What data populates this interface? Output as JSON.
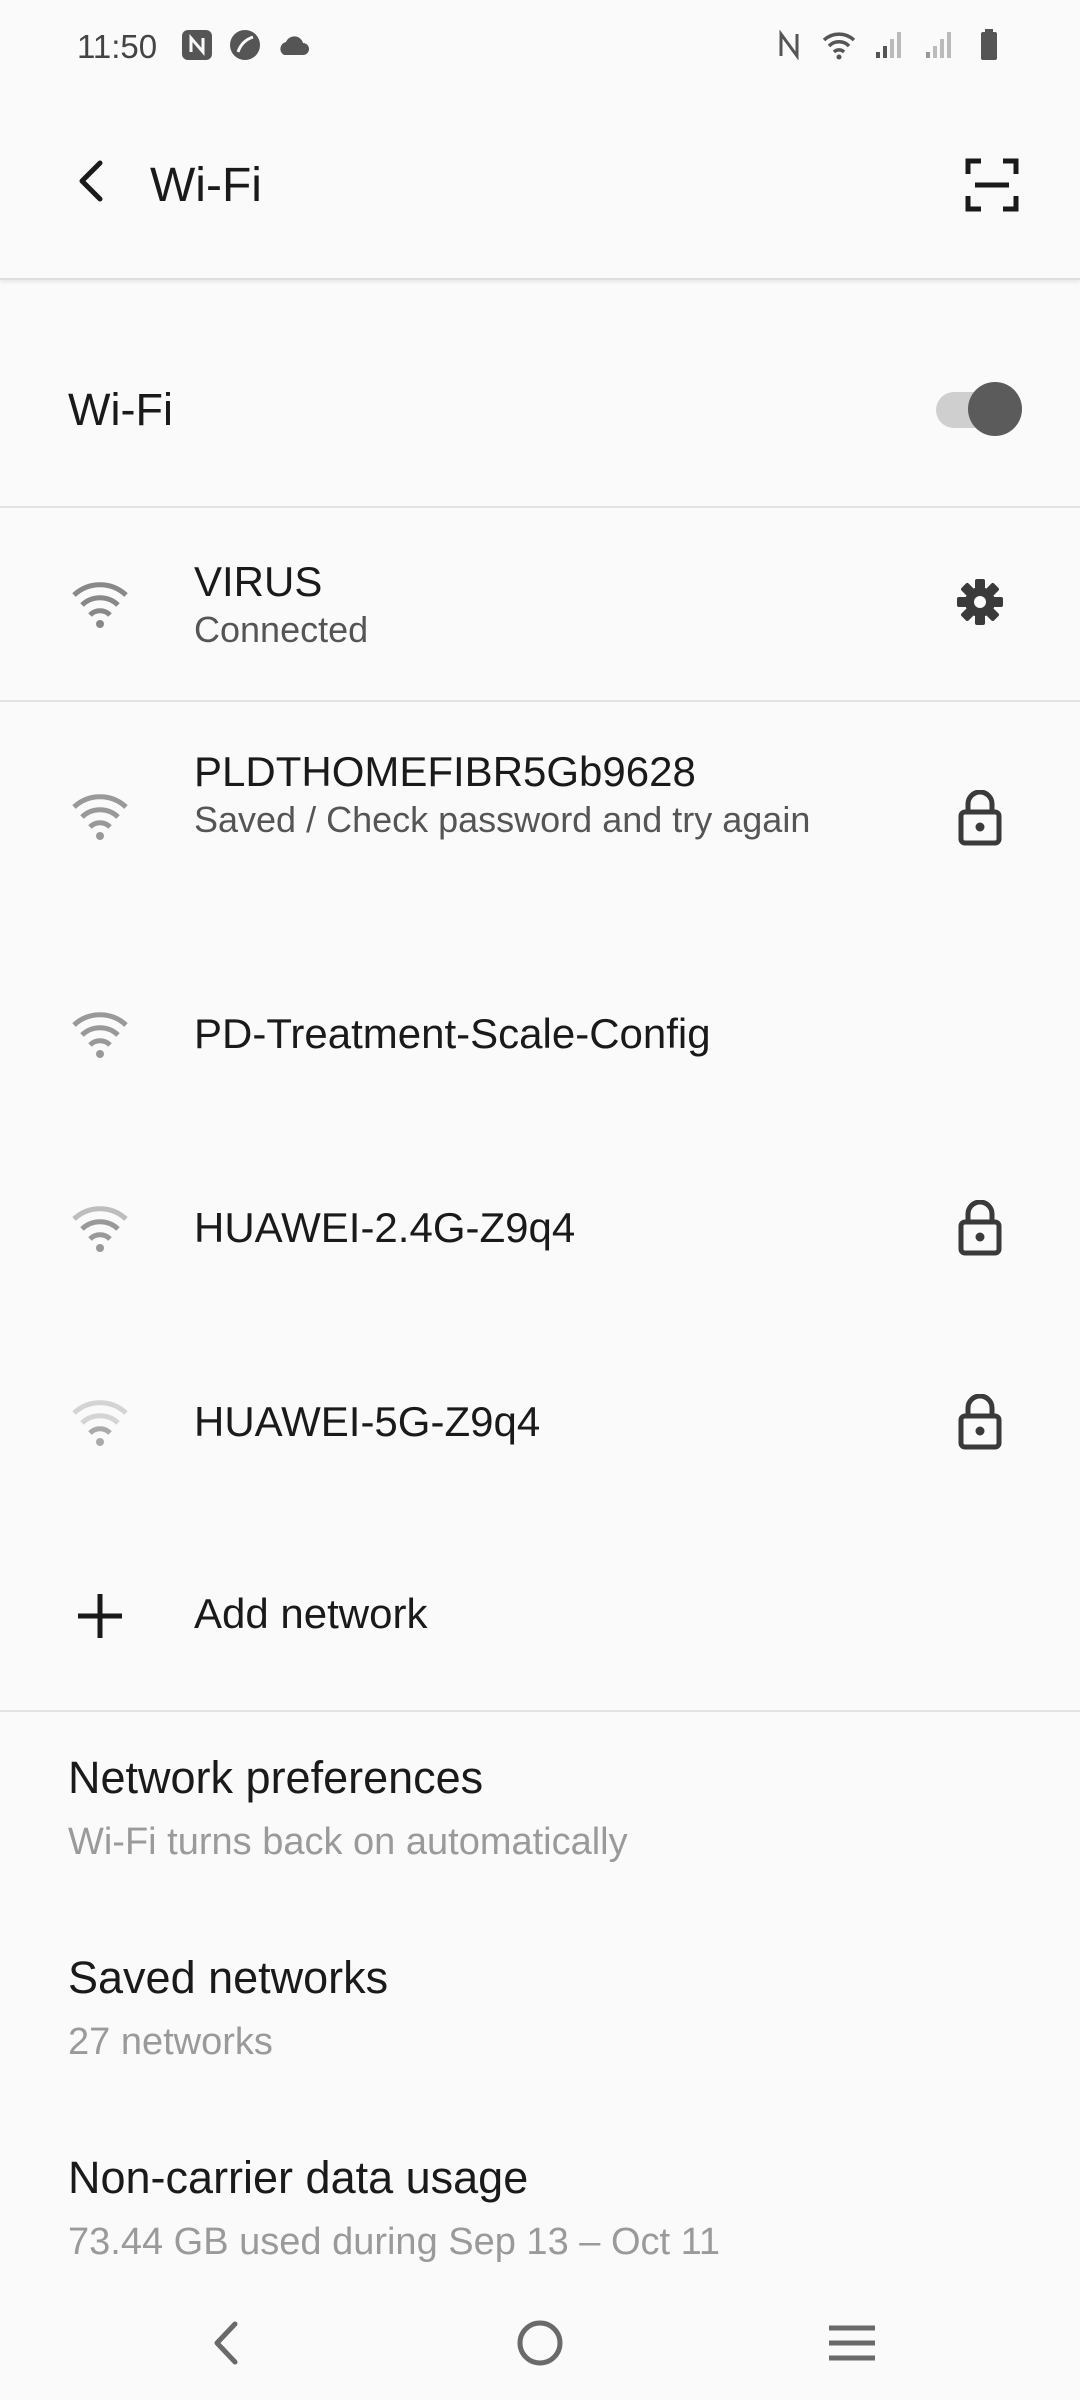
{
  "status_bar": {
    "time": "11:50",
    "left_icons": [
      "nfc-icon",
      "leaf-icon",
      "cloud-icon"
    ],
    "right_icons": [
      "nfc-icon",
      "wifi-icon",
      "signal-icon",
      "signal-icon",
      "battery-icon"
    ]
  },
  "app_bar": {
    "title": "Wi-Fi",
    "back_icon": "back-arrow-icon",
    "action_icon": "qr-scan-icon"
  },
  "master_toggle": {
    "label": "Wi-Fi",
    "enabled": true
  },
  "connected_network": {
    "name": "VIRUS",
    "status": "Connected",
    "trailing_icon": "gear-icon"
  },
  "networks": [
    {
      "name": "PLDTHOMEFIBR5Gb9628",
      "status": "Saved / Check password and try again",
      "secured": true
    },
    {
      "name": "PD-Treatment-Scale-Config",
      "status": "",
      "secured": false
    },
    {
      "name": "HUAWEI-2.4G-Z9q4",
      "status": "",
      "secured": true
    },
    {
      "name": "HUAWEI-5G-Z9q4",
      "status": "",
      "secured": true
    }
  ],
  "add_network": {
    "label": "Add network"
  },
  "preferences": [
    {
      "title": "Network preferences",
      "subtitle": "Wi-Fi turns back on automatically"
    },
    {
      "title": "Saved networks",
      "subtitle": "27 networks"
    },
    {
      "title": "Non-carrier data usage",
      "subtitle": "73.44 GB used during Sep 13 – Oct 11"
    }
  ],
  "nav_bar": {
    "icons": [
      "nav-back-icon",
      "nav-home-icon",
      "nav-recents-icon"
    ]
  },
  "colors": {
    "background": "#fafafa",
    "text_primary": "#1a1a1a",
    "text_secondary": "#9a9a9a",
    "icon": "#3a3a3a",
    "toggle_thumb": "#5b5b5b",
    "toggle_track": "#cfcfcf"
  }
}
